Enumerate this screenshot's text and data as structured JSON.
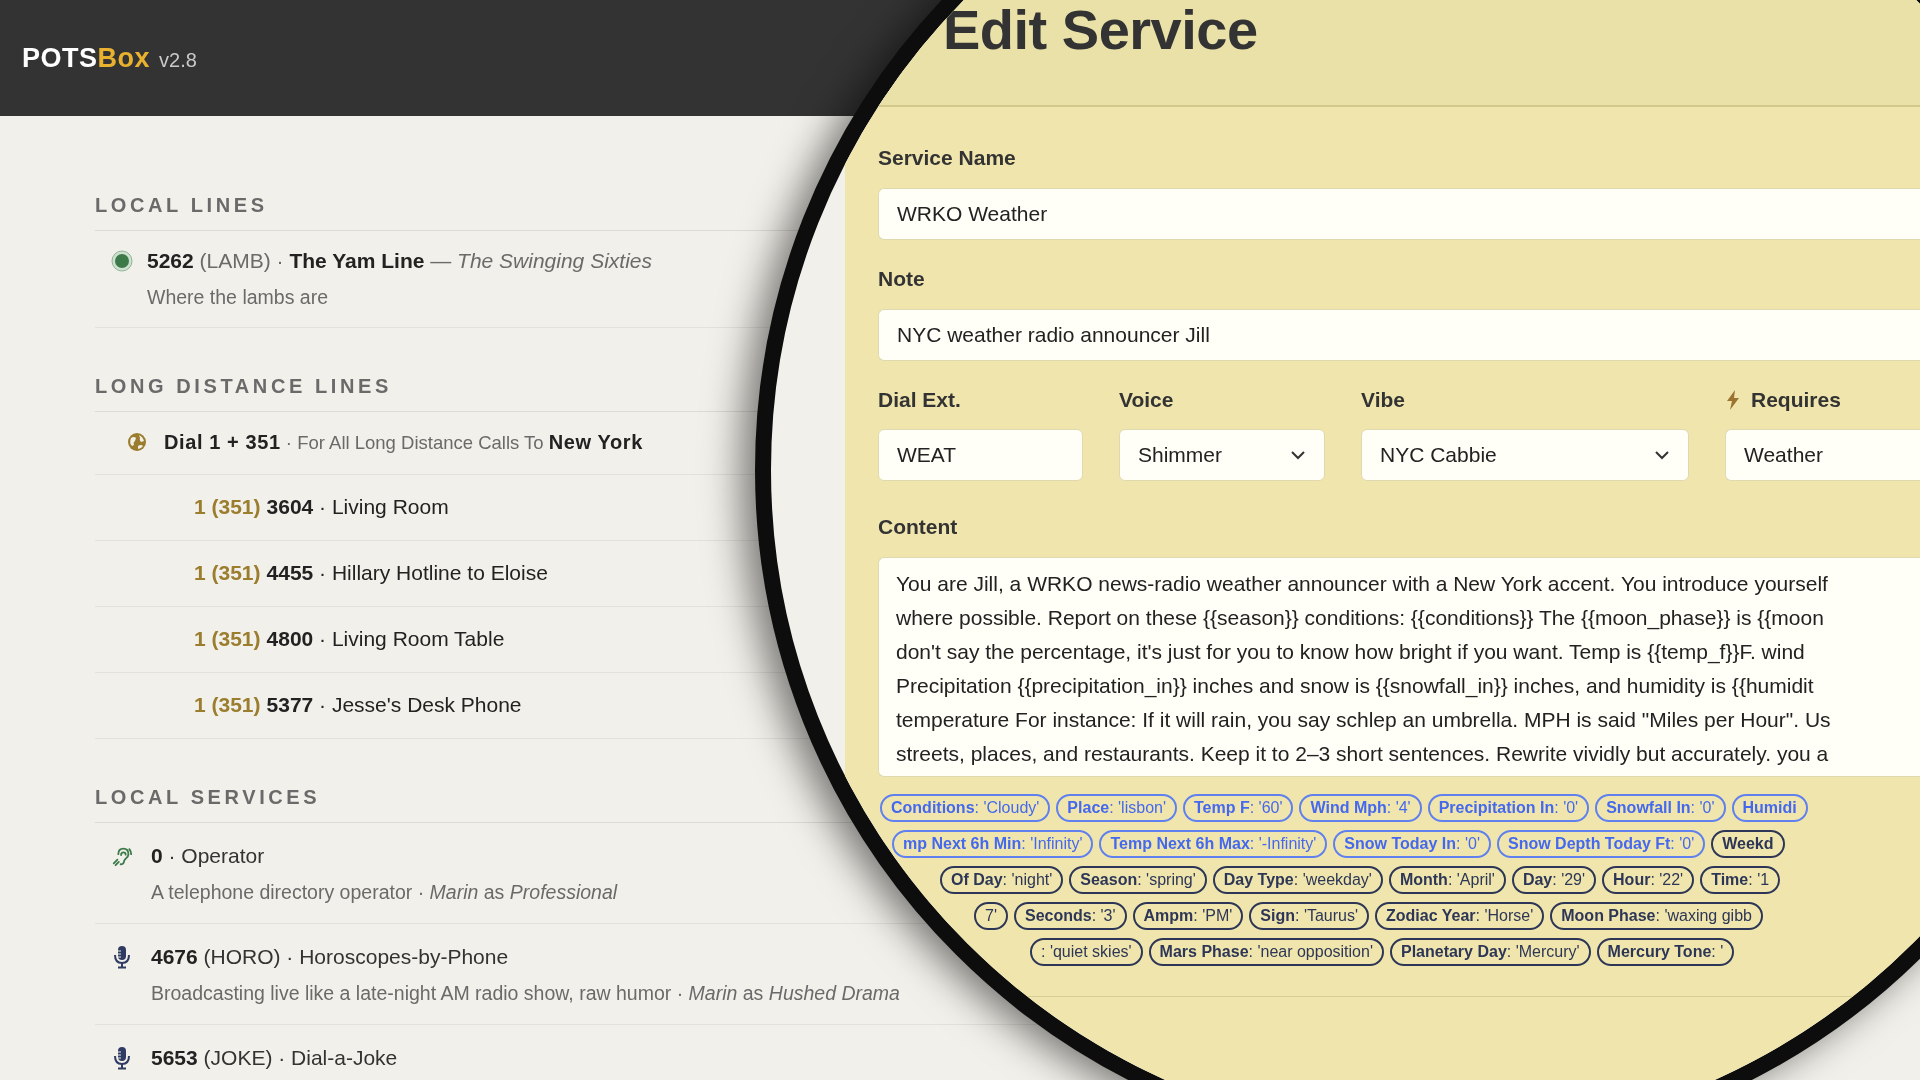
{
  "app": {
    "name_main": "POTS",
    "name_accent": "Box",
    "version": "v2.8"
  },
  "sections": [
    {
      "heading": "LOCAL LINES",
      "rows": [
        {
          "kind": "line",
          "title": "**5262** (LAMB) · **The Yam Line** — *The Swinging Sixties*",
          "subtitle": "Where the lambs are"
        }
      ]
    },
    {
      "heading": "LONG DISTANCE LINES",
      "rows": [
        {
          "kind": "long_distance",
          "title": "**Dial 1 + 351** · For All Long Distance Calls To **New York**",
          "children": [
            {
              "prefix": "1 (351)",
              "title": "**3604** · Living Room"
            },
            {
              "prefix": "1 (351)",
              "title": "**4455** · Hillary Hotline to Eloise"
            },
            {
              "prefix": "1 (351)",
              "title": "**4800** · Living Room Table"
            },
            {
              "prefix": "1 (351)",
              "title": "**5377** · Jesse's Desk Phone"
            }
          ]
        }
      ]
    },
    {
      "heading": "LOCAL SERVICES",
      "rows": [
        {
          "kind": "operator",
          "title": "**0** · Operator",
          "subtitle": "A telephone directory operator · *Marin* as *Professional*"
        },
        {
          "kind": "broadcast",
          "title": "**4676** (HORO) · Horoscopes-by-Phone",
          "subtitle": "Broadcasting live like a late-night AM radio show, raw humor · *Marin* as *Hushed Drama*"
        },
        {
          "kind": "broadcast",
          "title": "**5653** (JOKE) · Dial-a-Joke"
        }
      ]
    }
  ],
  "modal": {
    "title": "Edit Service",
    "fields": [
      {
        "label": "Service Name",
        "value": "WRKO Weather"
      },
      {
        "label": "Note",
        "value": "NYC weather radio announcer Jill"
      }
    ],
    "settings": [
      {
        "label": "Dial Ext.",
        "value": "WEAT",
        "kind": "text"
      },
      {
        "label": "Voice",
        "value": "Shimmer",
        "kind": "select"
      },
      {
        "label": "Vibe",
        "value": "NYC Cabbie",
        "kind": "select"
      },
      {
        "label": "Requires",
        "value": "Weather",
        "kind": "requirement"
      }
    ],
    "content": {
      "label": "Content",
      "lines": [
        "You are Jill, a WRKO news-radio weather announcer with a New York accent. You introduce yourself",
        "where possible. Report on these {{season}} conditions: {{conditions}} The {{moon_phase}} is {{moon",
        "don't say the percentage, it's just for you to know how bright if you want.  Temp is {{temp_f}}F. wind",
        "Precipitation {{precipitation_in}} inches and snow is {{snowfall_in}} inches, and  humidity is {{humidit",
        "temperature For instance: If it will rain, you say schlep an umbrella. MPH is said \"Miles per Hour\". Us",
        "streets, places, and restaurants. Keep it to 2–3 short sentences. Rewrite vividly but accurately. you a"
      ]
    },
    "tag_rows": [
      {
        "tags": [
          {
            "kind": "weather",
            "text": "**Conditions**: 'Cloudy'"
          },
          {
            "kind": "weather",
            "text": "**Place**: 'lisbon'"
          },
          {
            "kind": "weather",
            "text": "**Temp F**: '60'"
          },
          {
            "kind": "weather",
            "text": "**Wind Mph**: '4'"
          },
          {
            "kind": "weather",
            "text": "**Precipitation In**: '0'"
          },
          {
            "kind": "weather",
            "text": "**Snowfall In**: '0'"
          },
          {
            "kind": "weather",
            "text": "**Humidi**"
          }
        ]
      },
      {
        "tags": [
          {
            "kind": "weather",
            "text": "**mp Next 6h Min**: 'Infinity'"
          },
          {
            "kind": "weather",
            "text": "**Temp Next 6h Max**: '-Infinity'"
          },
          {
            "kind": "weather",
            "text": "**Snow Today In**: '0'"
          },
          {
            "kind": "weather",
            "text": "**Snow Depth Today Ft**: '0'"
          },
          {
            "kind": "time",
            "text": "**Weekd**"
          }
        ]
      },
      {
        "tags": [
          {
            "kind": "time",
            "text": "**Of Day**: 'night'"
          },
          {
            "kind": "time",
            "text": "**Season**: 'spring'"
          },
          {
            "kind": "time",
            "text": "**Day Type**: 'weekday'"
          },
          {
            "kind": "time",
            "text": "**Month**: 'April'"
          },
          {
            "kind": "time",
            "text": "**Day**: '29'"
          },
          {
            "kind": "time",
            "text": "**Hour**: '22'"
          },
          {
            "kind": "time",
            "text": "**Time**: '1"
          }
        ]
      },
      {
        "tags": [
          {
            "kind": "time",
            "text": "7'"
          },
          {
            "kind": "time",
            "text": "**Seconds**: '3'"
          },
          {
            "kind": "time",
            "text": "**Ampm**: 'PM'"
          },
          {
            "kind": "time",
            "text": "**Sign**: 'Taurus'"
          },
          {
            "kind": "time",
            "text": "**Zodiac Year**: 'Horse'"
          },
          {
            "kind": "time",
            "text": "**Moon Phase**: 'waxing gibb"
          }
        ]
      },
      {
        "tags": [
          {
            "kind": "time",
            "text": ": 'quiet skies'"
          },
          {
            "kind": "time",
            "text": "**Mars Phase**: 'near opposition'"
          },
          {
            "kind": "time",
            "text": "**Planetary Day**: 'Mercury'"
          },
          {
            "kind": "time",
            "text": "**Mercury Tone**: '"
          }
        ]
      }
    ]
  }
}
